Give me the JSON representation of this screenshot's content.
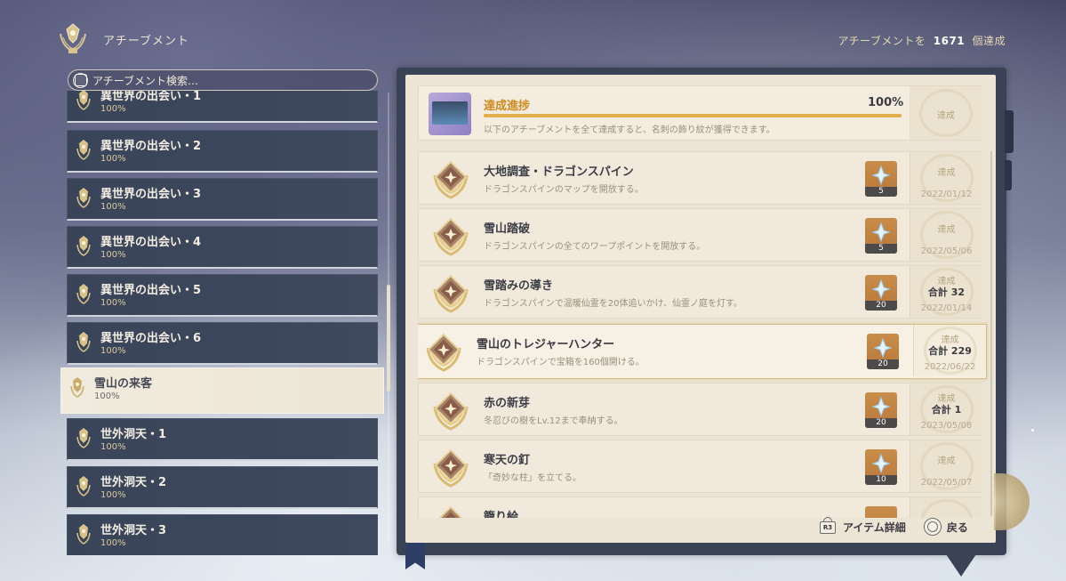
{
  "header": {
    "title": "アチーブメント",
    "count_prefix": "アチーブメントを",
    "count_value": "1671",
    "count_suffix": "個達成"
  },
  "search": {
    "placeholder": "アチーブメント検索…"
  },
  "categories": [
    {
      "name": "異世界の出会い・1",
      "percent": "100%"
    },
    {
      "name": "異世界の出会い・2",
      "percent": "100%"
    },
    {
      "name": "異世界の出会い・3",
      "percent": "100%"
    },
    {
      "name": "異世界の出会い・4",
      "percent": "100%"
    },
    {
      "name": "異世界の出会い・5",
      "percent": "100%"
    },
    {
      "name": "異世界の出会い・6",
      "percent": "100%"
    },
    {
      "name": "雪山の来客",
      "percent": "100%"
    },
    {
      "name": "世外洞天・1",
      "percent": "100%"
    },
    {
      "name": "世外洞天・2",
      "percent": "100%"
    },
    {
      "name": "世外洞天・3",
      "percent": "100%"
    }
  ],
  "progress": {
    "title": "達成進捗",
    "percent": "100%",
    "fill_fraction": 1.0,
    "description": "以下のアチーブメントを全て達成すると、名刺の飾り紋が獲得できます。",
    "status": "達成"
  },
  "achievements": [
    {
      "title": "大地調査・ドラゴンスパイン",
      "description": "ドラゴンスパインのマップを開放する。",
      "reward_qty": "5",
      "status": "達成",
      "total": "",
      "date": "2022/01/12"
    },
    {
      "title": "雪山踏破",
      "description": "ドラゴンスパインの全てのワープポイントを開放する。",
      "reward_qty": "5",
      "status": "達成",
      "total": "",
      "date": "2022/05/06"
    },
    {
      "title": "雪踏みの導き",
      "description": "ドラゴンスパインで温暖仙霊を20体追いかけ、仙霊ノ庭を灯す。",
      "reward_qty": "20",
      "status": "達成",
      "total": "合計 32",
      "date": "2022/01/14"
    },
    {
      "title": "雪山のトレジャーハンター",
      "description": "ドラゴンスパインで宝箱を160個開ける。",
      "reward_qty": "20",
      "status": "達成",
      "total": "合計 229",
      "date": "2022/06/22"
    },
    {
      "title": "赤の新芽",
      "description": "冬忍びの樹をLv.12まで奉納する。",
      "reward_qty": "20",
      "status": "達成",
      "total": "合計 1",
      "date": "2023/05/08"
    },
    {
      "title": "寒天の釘",
      "description": "「奇妙な柱」を立てる。",
      "reward_qty": "10",
      "status": "達成",
      "total": "",
      "date": "2022/05/07"
    },
    {
      "title": "籠り絵",
      "description": "",
      "reward_qty": "",
      "status": "",
      "total": "",
      "date": ""
    }
  ],
  "footer": {
    "r3_label": "R3",
    "item_details": "アイテム詳細",
    "back": "戻る"
  },
  "colors": {
    "progress_title": "#d18a1f",
    "progress_bar": "#e3ad4a",
    "category_bg": "#3a4459",
    "active_category_bg": "#f1ebde",
    "page_bg": "#ece4d4",
    "reward_bg": "#c98d4a"
  }
}
